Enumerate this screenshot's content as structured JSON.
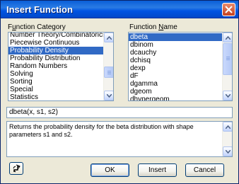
{
  "window": {
    "title": "Insert Function",
    "close_icon": "close-x-icon"
  },
  "category": {
    "label_prefix": "F",
    "label_underlined": "u",
    "label_rest": "nction Category",
    "items": [
      "Number Theory/Combinatorics",
      "Piecewise Continuous",
      "Probability Density",
      "Probability Distribution",
      "Random Numbers",
      "Solving",
      "Sorting",
      "Special",
      "Statistics"
    ],
    "selected_index": 2
  },
  "function_names": {
    "label_prefix": "Function ",
    "label_underlined": "N",
    "label_rest": "ame",
    "items": [
      "dbeta",
      "dbinom",
      "dcauchy",
      "dchisq",
      "dexp",
      "dF",
      "dgamma",
      "dgeom",
      "dhypergeom"
    ],
    "selected_index": 0
  },
  "signature": "dbeta(x, s1, s2)",
  "description": "Returns the probability density for the beta distribution with shape parameters s1 and s2.",
  "buttons": {
    "ok": "OK",
    "insert": "Insert",
    "cancel": "Cancel",
    "help_icon": "help-arrow-icon"
  }
}
